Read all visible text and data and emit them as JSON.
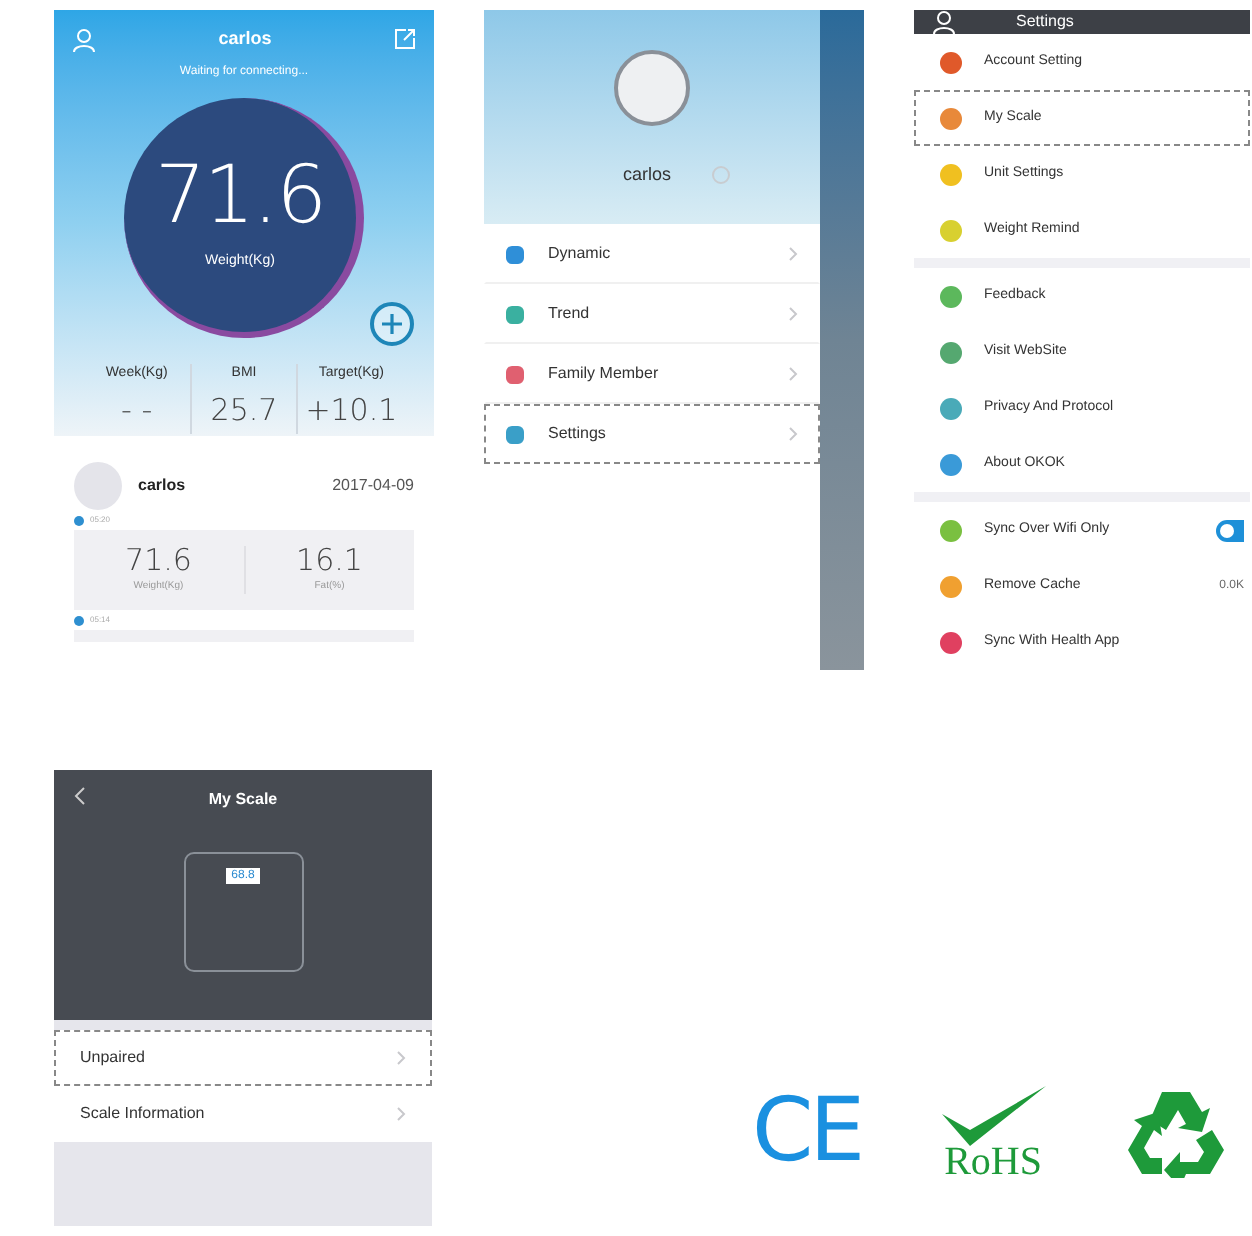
{
  "home_screen": {
    "title": "carlos",
    "status": "Waiting for connecting...",
    "weight": "71.6",
    "weight_label": "Weight(Kg)",
    "stats": [
      {
        "label": "Week(Kg)",
        "value": "- -"
      },
      {
        "label": "BMI",
        "value": "25.7"
      },
      {
        "label": "Target(Kg)",
        "value": "+10.1"
      }
    ],
    "record": {
      "name": "carlos",
      "date": "2017-04-09",
      "time": "05:20",
      "values": [
        {
          "value": "71.6",
          "label": "Weight(Kg)"
        },
        {
          "value": "16.1",
          "label": "Fat(%)"
        }
      ],
      "next_time": "05:14"
    }
  },
  "drawer": {
    "user_name": "carlos",
    "items": [
      {
        "label": "Dynamic",
        "color": "#2f8fd8",
        "selected": false
      },
      {
        "label": "Trend",
        "color": "#3ab0a0",
        "selected": false
      },
      {
        "label": "Family Member",
        "color": "#e06070",
        "selected": false
      },
      {
        "label": "Settings",
        "color": "#3a9fc8",
        "selected": true
      }
    ]
  },
  "settings_screen": {
    "title": "Settings",
    "groups": [
      {
        "items": [
          {
            "kind": "link",
            "label": "Account Setting",
            "color": "#e0592a",
            "selected": false
          },
          {
            "kind": "link",
            "label": "My Scale",
            "color": "#e8893a",
            "selected": true
          },
          {
            "kind": "link",
            "label": "Unit Settings",
            "color": "#f0c020",
            "selected": false
          },
          {
            "kind": "link",
            "label": "Weight Remind",
            "color": "#d8d030",
            "selected": false
          }
        ]
      },
      {
        "items": [
          {
            "kind": "link",
            "label": "Feedback",
            "color": "#5cb85c",
            "selected": false
          },
          {
            "kind": "link",
            "label": "Visit WebSite",
            "color": "#55a870",
            "selected": false
          },
          {
            "kind": "link",
            "label": "Privacy And Protocol",
            "color": "#4aaab8",
            "selected": false
          },
          {
            "kind": "link",
            "label": "About OKOK",
            "color": "#3a9ad8",
            "selected": false
          }
        ]
      },
      {
        "items": [
          {
            "kind": "toggle",
            "label": "Sync Over Wifi Only",
            "color": "#7ac040",
            "selected": false,
            "on": true
          },
          {
            "kind": "value",
            "label": "Remove Cache",
            "color": "#f0a030",
            "selected": false,
            "value": "0.0K"
          },
          {
            "kind": "link",
            "label": "Sync With Health App",
            "color": "#e04060",
            "selected": false
          }
        ]
      }
    ]
  },
  "my_scale_screen": {
    "title": "My Scale",
    "display": "68.8",
    "items": [
      {
        "label": "Unpaired",
        "selected": true
      },
      {
        "label": "Scale Information",
        "selected": false
      }
    ]
  },
  "certifications": [
    {
      "kind": "ce",
      "text": "CE"
    },
    {
      "kind": "rohs",
      "text": "RoHS"
    },
    {
      "kind": "recycle"
    }
  ]
}
